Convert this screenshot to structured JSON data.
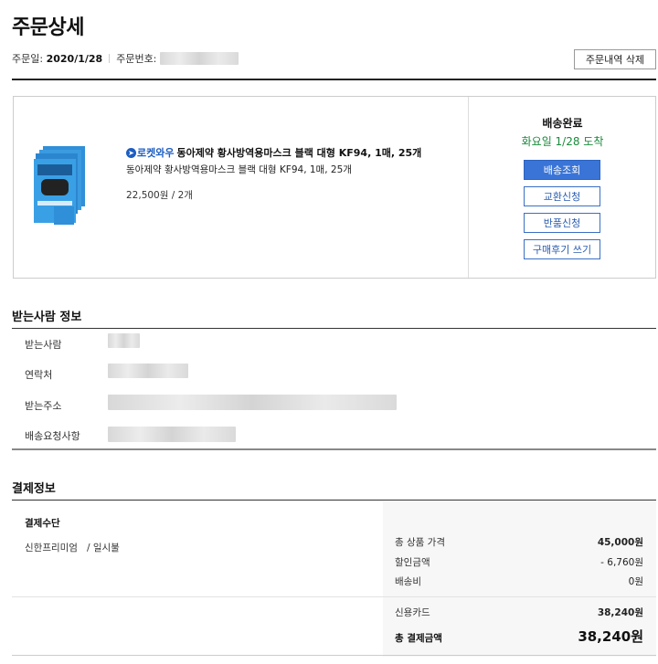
{
  "header": {
    "title": "주문상세",
    "order_date_label": "주문일:",
    "order_date": "2020/1/28",
    "order_number_label": "주문번호:",
    "delete_button": "주문내역 삭제"
  },
  "order": {
    "rocket_label": "로켓와우",
    "product_title": "동아제약 황사방역용마스크 블랙 대형 KF94, 1매, 25개",
    "product_subtitle": "동아제약 황사방역용마스크 블랙 대형 KF94, 1매, 25개",
    "price_qty": "22,500원 / 2개",
    "status": "배송완료",
    "arrival": "화요일 1/28 도착",
    "buttons": [
      "배송조회",
      "교환신청",
      "반품신청",
      "구매후기 쓰기"
    ],
    "colors": {
      "primary": "#3a74d6",
      "arrival": "#1a8a3c",
      "rocket": "#1d5ec2"
    }
  },
  "recipient": {
    "title": "받는사람 정보",
    "labels": [
      "받는사람",
      "연락처",
      "받는주소",
      "배송요청사항"
    ]
  },
  "payment": {
    "title": "결제정보",
    "method_label": "결제수단",
    "method_value": "신한프리미엄   / 일시불",
    "rows": [
      {
        "label": "총 상품 가격",
        "value": "45,000원"
      },
      {
        "label": "할인금액",
        "value": "- 6,760원"
      },
      {
        "label": "배송비",
        "value": "0원"
      }
    ],
    "card_label": "신용카드",
    "card_value": "38,240원",
    "total_label": "총 결제금액",
    "total_value": "38,240원"
  }
}
